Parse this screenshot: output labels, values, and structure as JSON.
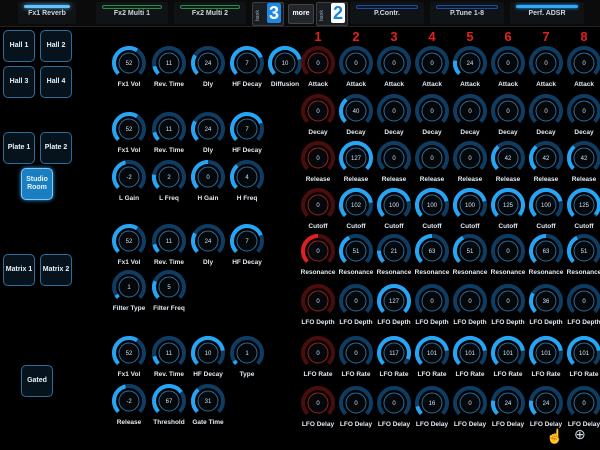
{
  "tabs": {
    "fx1_reverb": "Fx1 Reverb",
    "fx2_multi1": "Fx2 Multi 1",
    "fx2_multi2": "Fx2 Multi 2",
    "bank_label": "bank",
    "bank_a": "3",
    "more": "more",
    "bank_b": "2",
    "p_contr": "P.Contr.",
    "p_tune": "P.Tune 1-8",
    "perf_adsr": "Perf. ADSR"
  },
  "presets": {
    "hall1": "Hall 1",
    "hall2": "Hall 2",
    "hall3": "Hall 3",
    "hall4": "Hall 4",
    "plate1": "Plate 1",
    "plate2": "Plate 2",
    "studio": "Studio Room",
    "matrix1": "Matrix 1",
    "matrix2": "Matrix 2",
    "gated": "Gated"
  },
  "column_numbers": [
    "1",
    "2",
    "3",
    "4",
    "5",
    "6",
    "7",
    "8"
  ],
  "colors": {
    "accent": "#27a5f5",
    "active_red": "#e02020",
    "background": "#000000"
  },
  "fx_knobs": [
    {
      "label": "Fx1 Vol",
      "value": "52",
      "level": 0.62
    },
    {
      "label": "Rev. Time",
      "value": "11",
      "level": 0.12
    },
    {
      "label": "Dly",
      "value": "24",
      "level": 0.28
    },
    {
      "label": "HF Decay",
      "value": "7",
      "level": 0.75
    },
    {
      "label": "Diffusion",
      "value": "10",
      "level": 0.78
    },
    {
      "label": "Fx1 Vol",
      "value": "52",
      "level": 0.62
    },
    {
      "label": "Rev. Time",
      "value": "11",
      "level": 0.12
    },
    {
      "label": "Dly",
      "value": "24",
      "level": 0.28
    },
    {
      "label": "HF Decay",
      "value": "7",
      "level": 0.75
    },
    {
      "label": "L Gain",
      "value": "-2",
      "level": 0.45
    },
    {
      "label": "L Freq",
      "value": "2",
      "level": 0.2
    },
    {
      "label": "H Gain",
      "value": "0",
      "level": 0.5
    },
    {
      "label": "H Freq",
      "value": "4",
      "level": 0.35
    },
    {
      "label": "Fx1 Vol",
      "value": "52",
      "level": 0.62
    },
    {
      "label": "Rev. Time",
      "value": "11",
      "level": 0.12
    },
    {
      "label": "Dly",
      "value": "24",
      "level": 0.28
    },
    {
      "label": "HF Decay",
      "value": "7",
      "level": 0.75
    },
    {
      "label": "Filter Type",
      "value": "1",
      "level": 0.05
    },
    {
      "label": "Filter Freq",
      "value": "5",
      "level": 0.25
    },
    {
      "label": "Fx1 Vol",
      "value": "52",
      "level": 0.62
    },
    {
      "label": "Rev. Time",
      "value": "11",
      "level": 0.12
    },
    {
      "label": "HF Decay",
      "value": "10",
      "level": 0.8
    },
    {
      "label": "Type",
      "value": "1",
      "level": 0.05
    },
    {
      "label": "Release",
      "value": "-2",
      "level": 0.45
    },
    {
      "label": "Threshold",
      "value": "67",
      "level": 0.7
    },
    {
      "label": "Gate Time",
      "value": "31",
      "level": 0.35
    }
  ],
  "grid_rows": [
    {
      "label": "Attack",
      "values": [
        "0",
        "0",
        "0",
        "0",
        "24",
        "0",
        "0",
        "0"
      ],
      "levels": [
        0.0,
        0.0,
        0.0,
        0.0,
        0.2,
        0.0,
        0.0,
        0.0
      ],
      "red": [
        true,
        false,
        false,
        false,
        false,
        false,
        false,
        false
      ]
    },
    {
      "label": "Decay",
      "values": [
        "0",
        "40",
        "0",
        "0",
        "0",
        "0",
        "0",
        "0"
      ],
      "levels": [
        0.0,
        0.35,
        0.0,
        0.0,
        0.0,
        0.0,
        0.0,
        0.0
      ],
      "red": [
        true,
        false,
        false,
        false,
        false,
        false,
        false,
        false
      ]
    },
    {
      "label": "Release",
      "values": [
        "0",
        "127",
        "0",
        "0",
        "0",
        "42",
        "42",
        "42"
      ],
      "levels": [
        0.0,
        1.0,
        0.0,
        0.0,
        0.0,
        0.35,
        0.35,
        0.35
      ],
      "red": [
        true,
        false,
        false,
        false,
        false,
        false,
        false,
        false
      ]
    },
    {
      "label": "Cutoff",
      "values": [
        "0",
        "102",
        "100",
        "100",
        "100",
        "125",
        "100",
        "125"
      ],
      "levels": [
        0.0,
        0.8,
        0.78,
        0.78,
        0.78,
        0.98,
        0.78,
        0.98
      ],
      "red": [
        true,
        false,
        false,
        false,
        false,
        false,
        false,
        false
      ]
    },
    {
      "label": "Resonance",
      "values": [
        "0",
        "51",
        "21",
        "63",
        "51",
        "0",
        "63",
        "51"
      ],
      "levels": [
        0.5,
        0.4,
        0.17,
        0.5,
        0.4,
        0.0,
        0.5,
        0.4
      ],
      "red": [
        true,
        false,
        false,
        false,
        false,
        false,
        false,
        false
      ]
    },
    {
      "label": "LFO Depth",
      "values": [
        "0",
        "0",
        "127",
        "0",
        "0",
        "0",
        "36",
        "0"
      ],
      "levels": [
        0.0,
        0.0,
        1.0,
        0.0,
        0.0,
        0.0,
        0.28,
        0.0
      ],
      "red": [
        true,
        false,
        false,
        false,
        false,
        false,
        false,
        false
      ]
    },
    {
      "label": "LFO Rate",
      "values": [
        "0",
        "0",
        "117",
        "101",
        "101",
        "101",
        "101",
        "101"
      ],
      "levels": [
        0.0,
        0.0,
        0.92,
        0.8,
        0.8,
        0.8,
        0.8,
        0.8
      ],
      "red": [
        true,
        false,
        false,
        false,
        false,
        false,
        false,
        false
      ]
    },
    {
      "label": "LFO Delay",
      "values": [
        "0",
        "0",
        "0",
        "16",
        "0",
        "24",
        "24",
        "0"
      ],
      "levels": [
        0.0,
        0.0,
        0.0,
        0.12,
        0.0,
        0.2,
        0.2,
        0.0
      ],
      "red": [
        true,
        false,
        false,
        false,
        false,
        false,
        false,
        false
      ]
    }
  ]
}
